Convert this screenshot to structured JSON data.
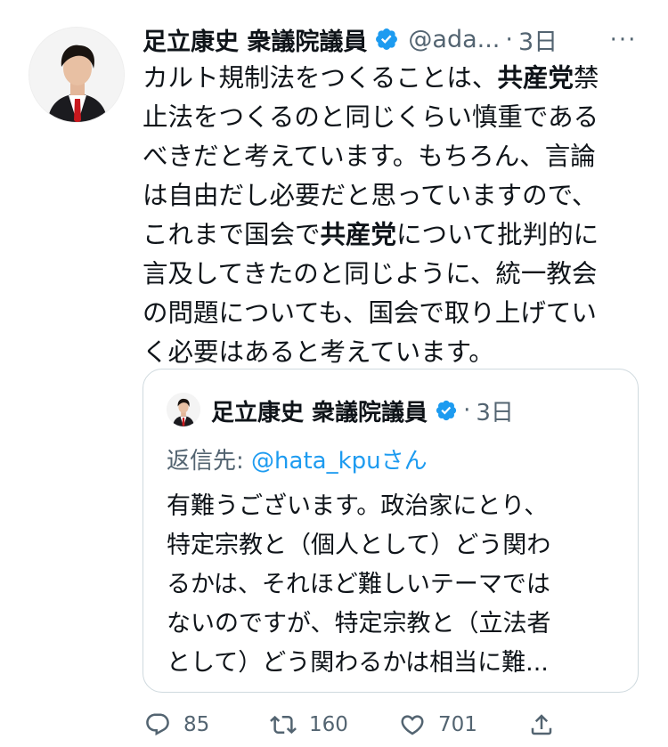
{
  "tweet": {
    "author_name": "足立康史 衆議院議員",
    "handle": "@ada...",
    "time": "3日",
    "more_label": "···",
    "body_lines": [
      [
        {
          "text": "カルト規制法をつくることは、"
        },
        {
          "text": "共産党",
          "bold": true
        },
        {
          "text": "禁"
        }
      ],
      [
        {
          "text": "止法をつくるのと同じくらい慎重である"
        }
      ],
      [
        {
          "text": "べきだと考えています。もちろん、言論"
        }
      ],
      [
        {
          "text": "は自由だし必要だと思っていますので、"
        }
      ],
      [
        {
          "text": "これまで国会で"
        },
        {
          "text": "共産党",
          "bold": true
        },
        {
          "text": "について批判的に"
        }
      ],
      [
        {
          "text": "言及してきたのと同じように、統一教会"
        }
      ],
      [
        {
          "text": "の問題についても、国会で取り上げてい"
        }
      ],
      [
        {
          "text": "く必要はあると考えています。"
        }
      ]
    ]
  },
  "quoted_tweet": {
    "author_name": "足立康史 衆議院議員",
    "time": "3日",
    "reply_prefix": "返信先: ",
    "reply_handle": "@hata_kpu",
    "reply_suffix": "さん",
    "body_lines": [
      "有難うございます。政治家にとり、",
      "特定宗教と（個人として）どう関わ",
      "るかは、それほど難しいテーマでは",
      "ないのですが、特定宗教と（立法者",
      "として）どう関わるかは相当に難..."
    ]
  },
  "actions": {
    "reply_count": "85",
    "retweet_count": "160",
    "like_count": "701"
  },
  "colors": {
    "verified_badge": "#1d9bf0",
    "link": "#1d9bf0",
    "secondary_text": "#536471",
    "border": "#cfd9de"
  },
  "icons": [
    "verified-badge-icon",
    "more-dots-icon",
    "reply-icon",
    "retweet-icon",
    "like-heart-icon",
    "share-icon"
  ]
}
